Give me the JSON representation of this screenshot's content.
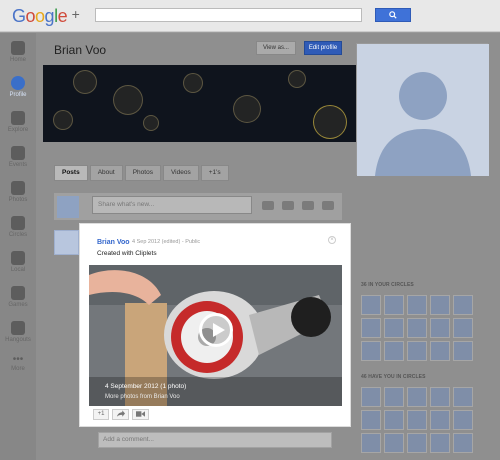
{
  "header": {
    "logo_text": "Google",
    "logo_plus": "+",
    "search_placeholder": "",
    "search_icon": "search-icon"
  },
  "nav": {
    "items": [
      {
        "label": "Home",
        "icon": "home-icon"
      },
      {
        "label": "Profile",
        "icon": "profile-icon",
        "active": true
      },
      {
        "label": "Explore",
        "icon": "explore-icon"
      },
      {
        "label": "Events",
        "icon": "events-icon"
      },
      {
        "label": "Photos",
        "icon": "photos-icon"
      },
      {
        "label": "Circles",
        "icon": "circles-icon"
      },
      {
        "label": "Local",
        "icon": "local-icon"
      },
      {
        "label": "Games",
        "icon": "games-icon"
      },
      {
        "label": "Hangouts",
        "icon": "hangouts-icon"
      },
      {
        "label": "More",
        "icon": "more-icon"
      }
    ]
  },
  "profile": {
    "name": "Brian Voo",
    "view_as": "View as...",
    "edit_profile": "Edit profile"
  },
  "tabs": [
    "Posts",
    "About",
    "Photos",
    "Videos",
    "+1's"
  ],
  "share": {
    "placeholder": "Share what's new..."
  },
  "post": {
    "author": "Brian Voo",
    "meta": "4 Sep 2012 (edited)  -  Public",
    "text": "Created with Cliplets",
    "album_title": "4 September 2012 (1 photo)",
    "album_sub": "More photos from Brian Voo",
    "plus_one": "+1",
    "comment_placeholder": "Add a comment..."
  },
  "circles": {
    "in_your_circles": "36 IN YOUR CIRCLES",
    "have_you": "46 HAVE YOU IN CIRCLES"
  },
  "colors": {
    "accent": "#3366cc",
    "button_blue": "#2f5bb7"
  }
}
